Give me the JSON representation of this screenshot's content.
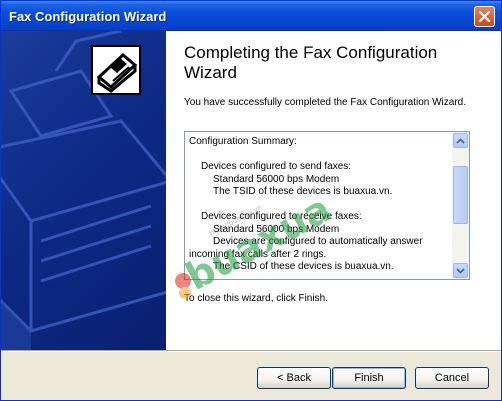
{
  "window": {
    "title": "Fax Configuration Wizard"
  },
  "page": {
    "heading": "Completing the Fax Configuration Wizard",
    "intro": "You have successfully completed the Fax Configuration Wizard.",
    "close_hint": "To close this wizard, click Finish."
  },
  "summary": {
    "lines": [
      "Configuration Summary:",
      "Devices configured to send faxes:",
      "Standard 56000 bps Modem",
      "The TSID of these devices is buaxua.vn.",
      "Devices configured to receive faxes:",
      "Standard 56000 bps Modem",
      "Devices are configured to automatically answer",
      "incoming fax calls after 2 rings.",
      "The CSID of these devices is buaxua.vn."
    ]
  },
  "watermark": {
    "text": "buaxua",
    "url": "http://buaxua.vn"
  },
  "buttons": {
    "back": "< Back",
    "finish": "Finish",
    "cancel": "Cancel"
  },
  "colors": {
    "titlebar": "#0a4fdc",
    "left_panel": "#0d2a86",
    "face": "#ece9d8",
    "close": "#c64a25"
  }
}
